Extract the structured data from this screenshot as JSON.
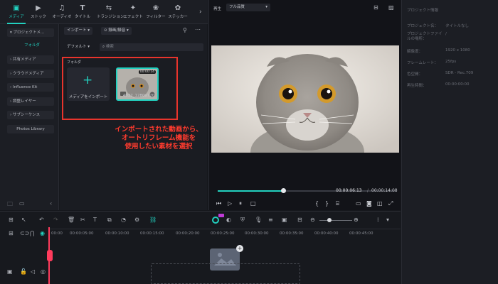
{
  "toolbar": {
    "items": [
      {
        "label": "メディア",
        "icon": "media-icon"
      },
      {
        "label": "ストック",
        "icon": "stock-icon"
      },
      {
        "label": "オーディオ",
        "icon": "audio-icon"
      },
      {
        "label": "タイトル",
        "icon": "title-icon"
      },
      {
        "label": "トランジション",
        "icon": "transition-icon"
      },
      {
        "label": "エフェクト",
        "icon": "effect-icon"
      },
      {
        "label": "フィルター",
        "icon": "filter-icon"
      },
      {
        "label": "ステッカー",
        "icon": "sticker-icon"
      }
    ]
  },
  "leftnav": {
    "project_media": "プロジェクトメ...",
    "folder": "フォルダ",
    "items": [
      "共有メディア",
      "クラウドメディア",
      "Influence Kit",
      "調整レイヤー",
      "サブシーケンス",
      "Photos Library"
    ]
  },
  "media": {
    "import_btn": "インポート",
    "record_btn": "録画/録音",
    "default_label": "デフォルト",
    "search_placeholder": "検索",
    "folder_header": "フォルダ",
    "import_tile_label": "メディアをインポート",
    "clip_label": "4032_1280x720",
    "clip_duration": "00:00:14"
  },
  "annotation": {
    "lines": [
      "インポートされた動画から、",
      "オートリフレーム機能を",
      "使用したい素材を選択"
    ]
  },
  "preview": {
    "play_label": "再生",
    "quality": "フル品質",
    "current_time": "00:00:06:13",
    "separator": "/",
    "total_time": "00:00:14:08",
    "progress": 0.37
  },
  "properties": {
    "header": "プロジェクト情報",
    "rows": [
      {
        "label": "プロジェクト名：",
        "value": "タイトルなし"
      },
      {
        "label": "プロジェクトファイルの場所：",
        "value": "/"
      },
      {
        "label": "解像度：",
        "value": "1920 x 1080"
      },
      {
        "label": "フレームレート：",
        "value": "25fps"
      },
      {
        "label": "色空間：",
        "value": "SDR - Rec.709"
      },
      {
        "label": "再生時間：",
        "value": "00:00:00:00"
      }
    ]
  },
  "timeline": {
    "ruler": [
      "00:00",
      "00:00:05:00",
      "00:00:10:00",
      "00:00:15:00",
      "00:00:20:00",
      "00:00:25:00",
      "00:00:30:00",
      "00:00:35:00",
      "00:00:40:00",
      "00:00:45:00"
    ]
  },
  "colors": {
    "accent": "#22d1c0",
    "highlight_red": "#e8342c",
    "playhead": "#ff3b5c"
  }
}
